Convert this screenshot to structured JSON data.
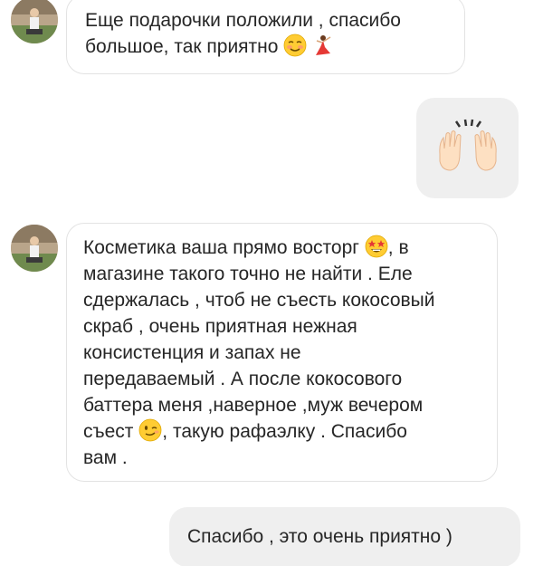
{
  "thread": {
    "messages": [
      {
        "direction": "incoming",
        "lines": [
          "Еще подарочки положили , спасибо",
          "большое, так приятно"
        ],
        "emojis": [
          "smiling-blush-emoji",
          "dancer-emoji"
        ]
      },
      {
        "direction": "outgoing",
        "emoji": "raising-hands-emoji"
      },
      {
        "direction": "incoming",
        "lines": [
          "Косметика ваша прямо восторг",
          ", в",
          "магазине такого точно не найти . Еле",
          "сдержалась , чтоб не съесть кокосовый",
          "скраб , очень приятная нежная",
          "консистенция и запах не",
          "передаваемый . А после кокосового",
          "баттера меня ,наверное ,муж вечером",
          "съест",
          ", такую рафаэлку . Спасибо",
          "вам ."
        ],
        "emojis": [
          "star-struck-emoji",
          "winking-emoji"
        ]
      },
      {
        "direction": "outgoing",
        "text": "Спасибо , это очень приятно )"
      }
    ]
  },
  "colors": {
    "incoming_border": "#e3e3e3",
    "outgoing_bg": "#efefef",
    "text": "#262626"
  }
}
